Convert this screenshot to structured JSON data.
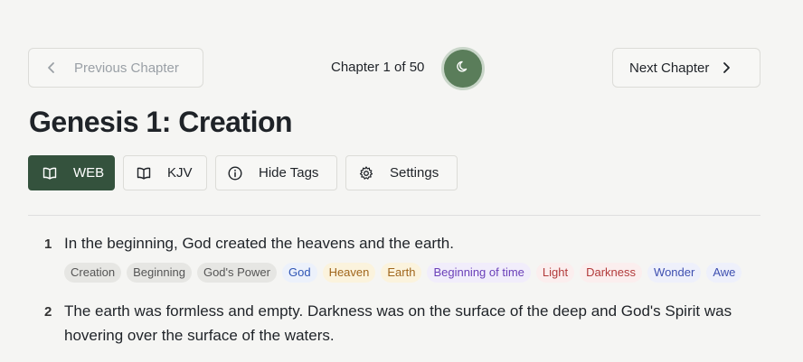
{
  "nav": {
    "prev_label": "Previous Chapter",
    "next_label": "Next Chapter",
    "chapter_counter": "Chapter 1 of 50"
  },
  "page_title": "Genesis 1: Creation",
  "toolbar": {
    "web_label": "WEB",
    "kjv_label": "KJV",
    "tags_label": "Hide Tags",
    "settings_label": "Settings"
  },
  "verses": [
    {
      "number": "1",
      "text": "In the beginning, God created the heavens and the earth.",
      "tags": [
        {
          "label": "Creation",
          "color": "gray"
        },
        {
          "label": "Beginning",
          "color": "gray"
        },
        {
          "label": "God's Power",
          "color": "gray"
        },
        {
          "label": "God",
          "color": "blue"
        },
        {
          "label": "Heaven",
          "color": "gold"
        },
        {
          "label": "Earth",
          "color": "gold"
        },
        {
          "label": "Beginning of time",
          "color": "purple"
        },
        {
          "label": "Light",
          "color": "red"
        },
        {
          "label": "Darkness",
          "color": "red"
        },
        {
          "label": "Wonder",
          "color": "indigo"
        },
        {
          "label": "Awe",
          "color": "indigo"
        }
      ]
    },
    {
      "number": "2",
      "text": "The earth was formless and empty. Darkness was on the surface of the deep and God's Spirit was hovering over the surface of the waters."
    }
  ],
  "colors": {
    "active_button": "#34523d",
    "theme_toggle": "#5a7d5a",
    "background": "#f5f5f3"
  },
  "icons": {
    "prev": "chevron-left-icon",
    "next": "chevron-right-icon",
    "theme": "moon-icon",
    "web": "book-open-icon",
    "kjv": "book-open-icon",
    "tags": "info-icon",
    "settings": "gear-icon"
  }
}
